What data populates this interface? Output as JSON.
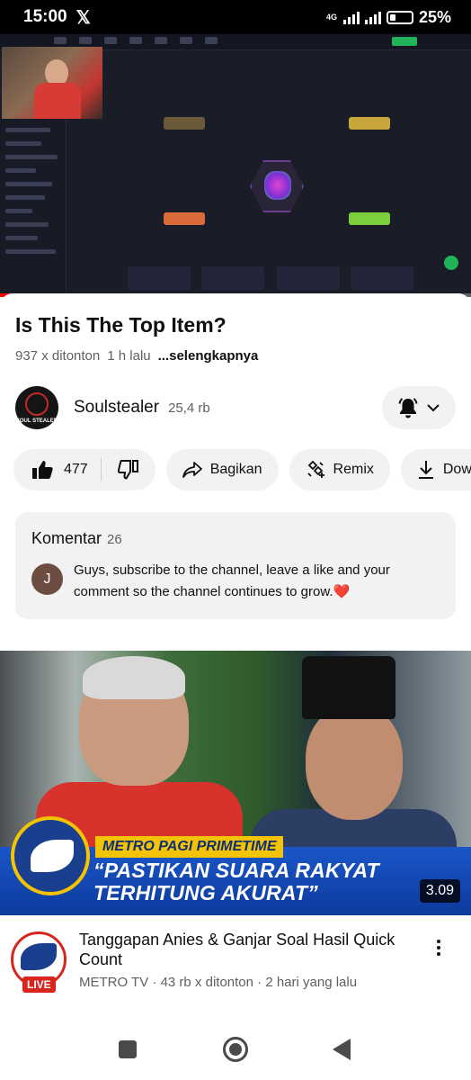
{
  "status_bar": {
    "time": "15:00",
    "x_icon": "x-logo-icon",
    "network": "4G",
    "battery": "25%"
  },
  "video": {
    "progress_percent": 12
  },
  "video_info": {
    "title": "Is This The Top Item?",
    "views": "937 x ditonton",
    "age": "1 h lalu",
    "more": "...selengkapnya"
  },
  "channel": {
    "name": "Soulstealer",
    "subscribers": "25,4 rb",
    "avatar_text": "SOUL STEALER",
    "bell_icon": "bell-icon"
  },
  "actions": {
    "likes": "477",
    "share": "Bagikan",
    "remix": "Remix",
    "download": "Download"
  },
  "comments": {
    "title": "Komentar",
    "count": "26",
    "avatar_letter": "J",
    "top_comment": "Guys, subscribe to the channel, leave a like and your comment so the channel continues to grow.",
    "heart": "❤️"
  },
  "recommended": {
    "thumbnail_tag": "METRO PAGI PRIMETIME",
    "thumbnail_headline": "“PASTIKAN SUARA RAKYAT TERHITUNG AKURAT”",
    "duration": "3.09",
    "title": "Tanggapan Anies & Ganjar Soal Hasil Quick Count",
    "channel": "METRO TV",
    "views": "43 rb x ditonton",
    "age": "2 hari yang lalu",
    "live_badge": "LIVE"
  },
  "colors": {
    "accent_red": "#ff0000",
    "live_red": "#d7261e",
    "chip_bg": "#f2f2f2",
    "secondary_text": "#606060"
  }
}
